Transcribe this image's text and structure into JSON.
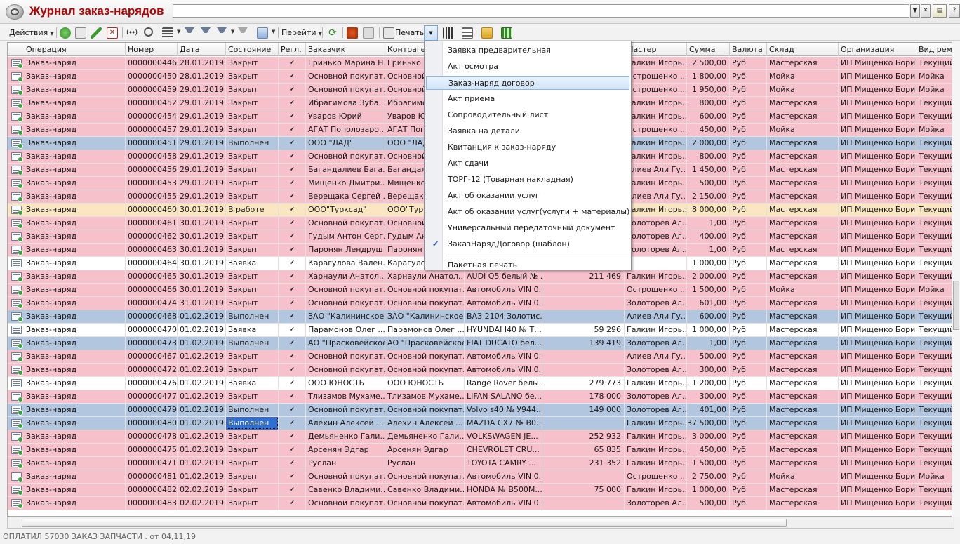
{
  "window": {
    "title": "Журнал заказ-нарядов",
    "search_value": ""
  },
  "toolbar": {
    "actions_label": "Действия",
    "goto_label": "Перейти",
    "print_label": "Печать"
  },
  "columns": [
    {
      "key": "operation",
      "label": "Операция"
    },
    {
      "key": "number",
      "label": "Номер"
    },
    {
      "key": "date",
      "label": "Дата"
    },
    {
      "key": "state",
      "label": "Состояние"
    },
    {
      "key": "regl",
      "label": "Регл."
    },
    {
      "key": "customer",
      "label": "Заказчик"
    },
    {
      "key": "counterparty",
      "label": "Контрагент"
    },
    {
      "key": "vehicle",
      "label": ""
    },
    {
      "key": "mileage",
      "label": ""
    },
    {
      "key": "master",
      "label": "Мастер"
    },
    {
      "key": "sum",
      "label": "Сумма"
    },
    {
      "key": "currency",
      "label": "Валюта"
    },
    {
      "key": "warehouse",
      "label": "Склад"
    },
    {
      "key": "org",
      "label": "Организация"
    },
    {
      "key": "repair",
      "label": "Вид ремо"
    }
  ],
  "colors": {
    "closed": "#f7c1cc",
    "done": "#b3c6df",
    "inwork": "#fbe6c2",
    "request": "#ffffff",
    "selection": "#2f6fd2"
  },
  "rows": [
    {
      "op": "Заказ-наряд",
      "num": "0000000446",
      "date": "28.01.2019",
      "state": "Закрыт",
      "cust": "Гринько Марина Н...",
      "cp": "Гринько М",
      "veh": "",
      "mil": "",
      "master": "Галкин Игорь...",
      "sum": "2 500,00",
      "cur": "Руб",
      "wh": "Мастерская",
      "org": "ИП Мищенко Бори...",
      "rep": "Текущий",
      "color": "#f7c1cc"
    },
    {
      "op": "Заказ-наряд",
      "num": "0000000450",
      "date": "28.01.2019",
      "state": "Закрыт",
      "cust": "Основной покупат...",
      "cp": "Основной",
      "veh": "",
      "mil": "",
      "master": "Острощенко ...",
      "sum": "1 800,00",
      "cur": "Руб",
      "wh": "Мойка",
      "org": "ИП Мищенко Бори...",
      "rep": "Мойка",
      "color": "#f7c1cc"
    },
    {
      "op": "Заказ-наряд",
      "num": "0000000459",
      "date": "29.01.2019",
      "state": "Закрыт",
      "cust": "Основной покупат...",
      "cp": "Основной",
      "veh": "",
      "mil": "",
      "master": "Острощенко ...",
      "sum": "1 950,00",
      "cur": "Руб",
      "wh": "Мойка",
      "org": "ИП Мищенко Бори...",
      "rep": "Мойка",
      "color": "#f7c1cc"
    },
    {
      "op": "Заказ-наряд",
      "num": "0000000452",
      "date": "29.01.2019",
      "state": "Закрыт",
      "cust": "Ибрагимова Зуба...",
      "cp": "Ибрагимов",
      "veh": "",
      "mil": "",
      "master": "Галкин Игорь...",
      "sum": "800,00",
      "cur": "Руб",
      "wh": "Мастерская",
      "org": "ИП Мищенко Бори...",
      "rep": "Текущий",
      "color": "#f7c1cc"
    },
    {
      "op": "Заказ-наряд",
      "num": "0000000454",
      "date": "29.01.2019",
      "state": "Закрыт",
      "cust": "Уваров Юрий",
      "cp": "Уваров Юр",
      "veh": "",
      "mil": "",
      "master": "Галкин Игорь...",
      "sum": "600,00",
      "cur": "Руб",
      "wh": "Мастерская",
      "org": "ИП Мищенко Бори...",
      "rep": "Текущий",
      "color": "#f7c1cc"
    },
    {
      "op": "Заказ-наряд",
      "num": "0000000457",
      "date": "29.01.2019",
      "state": "Закрыт",
      "cust": "АГАТ Пополозаро...",
      "cp": "АГАТ Попо",
      "veh": "",
      "mil": "",
      "master": "Острощенко ...",
      "sum": "450,00",
      "cur": "Руб",
      "wh": "Мойка",
      "org": "ИП Мищенко Бори...",
      "rep": "Мойка",
      "color": "#f7c1cc"
    },
    {
      "op": "Заказ-наряд",
      "num": "0000000451",
      "date": "29.01.2019",
      "state": "Выполнен",
      "cust": "ООО \"ЛАД\"",
      "cp": "ООО \"ЛАД\"",
      "veh": "",
      "mil": "",
      "master": "Галкин Игорь...",
      "sum": "2 000,00",
      "cur": "Руб",
      "wh": "Мастерская",
      "org": "ИП Мищенко Бори...",
      "rep": "Текущий",
      "color": "#b3c6df"
    },
    {
      "op": "Заказ-наряд",
      "num": "0000000458",
      "date": "29.01.2019",
      "state": "Закрыт",
      "cust": "Основной покупат...",
      "cp": "Основной",
      "veh": "",
      "mil": "",
      "master": "Галкин Игорь...",
      "sum": "800,00",
      "cur": "Руб",
      "wh": "Мастерская",
      "org": "ИП Мищенко Бори...",
      "rep": "Текущий",
      "color": "#f7c1cc"
    },
    {
      "op": "Заказ-наряд",
      "num": "0000000456",
      "date": "29.01.2019",
      "state": "Закрыт",
      "cust": "Багандалиев Бага...",
      "cp": "Багандали",
      "veh": "",
      "mil": "",
      "master": "Алиев Али Гу...",
      "sum": "1 450,00",
      "cur": "Руб",
      "wh": "Мастерская",
      "org": "ИП Мищенко Бори...",
      "rep": "Текущий",
      "color": "#f7c1cc"
    },
    {
      "op": "Заказ-наряд",
      "num": "0000000453",
      "date": "29.01.2019",
      "state": "Закрыт",
      "cust": "Мищенко Дмитри...",
      "cp": "Мищенко",
      "veh": "",
      "mil": "",
      "master": "Галкин Игорь...",
      "sum": "500,00",
      "cur": "Руб",
      "wh": "Мастерская",
      "org": "ИП Мищенко Бори...",
      "rep": "Текущий",
      "color": "#f7c1cc"
    },
    {
      "op": "Заказ-наряд",
      "num": "0000000455",
      "date": "29.01.2019",
      "state": "Закрыт",
      "cust": "Верещака Сергей ...",
      "cp": "Верещака",
      "veh": "",
      "mil": "",
      "master": "Алиев Али Гу...",
      "sum": "2 150,00",
      "cur": "Руб",
      "wh": "Мастерская",
      "org": "ИП Мищенко Бори...",
      "rep": "Текущий",
      "color": "#f7c1cc"
    },
    {
      "op": "Заказ-наряд",
      "num": "0000000460",
      "date": "30.01.2019",
      "state": "В работе",
      "cust": "ООО\"Турксад\"",
      "cp": "ООО\"Турк",
      "veh": "",
      "mil": "",
      "master": "Галкин Игорь...",
      "sum": "8 000,00",
      "cur": "Руб",
      "wh": "Мастерская",
      "org": "ИП Мищенко Бори...",
      "rep": "Текущий",
      "color": "#fbe6c2"
    },
    {
      "op": "Заказ-наряд",
      "num": "0000000461",
      "date": "30.01.2019",
      "state": "Закрыт",
      "cust": "Основной покупат...",
      "cp": "Основной",
      "veh": "",
      "mil": "",
      "master": "Золоторев Ал...",
      "sum": "1,00",
      "cur": "Руб",
      "wh": "Мастерская",
      "org": "ИП Мищенко Бори...",
      "rep": "Текущий",
      "color": "#f7c1cc"
    },
    {
      "op": "Заказ-наряд",
      "num": "0000000462",
      "date": "30.01.2019",
      "state": "Закрыт",
      "cust": "Гудым Антон Серг...",
      "cp": "Гудым Ант",
      "veh": "",
      "mil": "",
      "master": "Золоторев Ал...",
      "sum": "400,00",
      "cur": "Руб",
      "wh": "Мастерская",
      "org": "ИП Мищенко Бори...",
      "rep": "Текущий",
      "color": "#f7c1cc"
    },
    {
      "op": "Заказ-наряд",
      "num": "0000000463",
      "date": "30.01.2019",
      "state": "Закрыт",
      "cust": "Паронян Лендруш ...",
      "cp": "Паронян Л",
      "veh": "",
      "mil": "",
      "master": "Золоторев Ал...",
      "sum": "1,00",
      "cur": "Руб",
      "wh": "Мастерская",
      "org": "ИП Мищенко Бори...",
      "rep": "Текущий",
      "color": "#f7c1cc"
    },
    {
      "op": "Заказ-наряд",
      "num": "0000000464",
      "date": "30.01.2019",
      "state": "Заявка",
      "cust": "Карагулова Вален...",
      "cp": "Карагулов",
      "veh": "",
      "mil": "",
      "master": "",
      "sum": "1 000,00",
      "cur": "Руб",
      "wh": "Мастерская",
      "org": "ИП Мищенко Бори...",
      "rep": "Текущий",
      "color": "#ffffff"
    },
    {
      "op": "Заказ-наряд",
      "num": "0000000465",
      "date": "30.01.2019",
      "state": "Закрыт",
      "cust": "Харнаули Анатол...",
      "cp": "Харнаули Анатол...",
      "veh": "AUDI Q5 белый № ...",
      "mil": "211 469",
      "master": "Галкин Игорь...",
      "sum": "2 000,00",
      "cur": "Руб",
      "wh": "Мастерская",
      "org": "ИП Мищенко Бори...",
      "rep": "Текущий",
      "color": "#f7c1cc"
    },
    {
      "op": "Заказ-наряд",
      "num": "0000000466",
      "date": "30.01.2019",
      "state": "Закрыт",
      "cust": "Основной покупат...",
      "cp": "Основной покупат...",
      "veh": "Автомобиль VIN 0...",
      "mil": "",
      "master": "Острощенко ...",
      "sum": "1 500,00",
      "cur": "Руб",
      "wh": "Мойка",
      "org": "ИП Мищенко Бори...",
      "rep": "Мойка",
      "color": "#f7c1cc"
    },
    {
      "op": "Заказ-наряд",
      "num": "0000000474",
      "date": "31.01.2019",
      "state": "Закрыт",
      "cust": "Основной покупат...",
      "cp": "Основной покупат...",
      "veh": "Автомобиль VIN 0...",
      "mil": "",
      "master": "Золоторев Ал...",
      "sum": "601,00",
      "cur": "Руб",
      "wh": "Мастерская",
      "org": "ИП Мищенко Бори...",
      "rep": "Текущий",
      "color": "#f7c1cc"
    },
    {
      "op": "Заказ-наряд",
      "num": "0000000468",
      "date": "01.02.2019",
      "state": "Выполнен",
      "cust": "ЗАО \"Калининское\"",
      "cp": "ЗАО \"Калининское\"",
      "veh": "ВАЗ 2104 Золотис...",
      "mil": "",
      "master": "Алиев Али Гу...",
      "sum": "600,00",
      "cur": "Руб",
      "wh": "Мастерская",
      "org": "ИП Мищенко Бори...",
      "rep": "Текущий",
      "color": "#b3c6df"
    },
    {
      "op": "Заказ-наряд",
      "num": "0000000470",
      "date": "01.02.2019",
      "state": "Заявка",
      "cust": "Парамонов Олег ...",
      "cp": "Парамонов Олег ...",
      "veh": "HYUNDAI I40 № Т...",
      "mil": "59 296",
      "master": "Галкин Игорь...",
      "sum": "1 000,00",
      "cur": "Руб",
      "wh": "Мастерская",
      "org": "ИП Мищенко Бори...",
      "rep": "Текущий",
      "color": "#ffffff"
    },
    {
      "op": "Заказ-наряд",
      "num": "0000000473",
      "date": "01.02.2019",
      "state": "Выполнен",
      "cust": "АО \"Прасковейское",
      "cp": "АО \"Прасковейское",
      "veh": "FIAT DUCATO бел...",
      "mil": "139 419",
      "master": "Золоторев Ал...",
      "sum": "1,00",
      "cur": "Руб",
      "wh": "Мастерская",
      "org": "ИП Мищенко Бори...",
      "rep": "Текущий",
      "color": "#b3c6df"
    },
    {
      "op": "Заказ-наряд",
      "num": "0000000467",
      "date": "01.02.2019",
      "state": "Закрыт",
      "cust": "Основной покупат...",
      "cp": "Основной покупат...",
      "veh": "Автомобиль VIN 0...",
      "mil": "",
      "master": "Алиев Али Гу...",
      "sum": "500,00",
      "cur": "Руб",
      "wh": "Мастерская",
      "org": "ИП Мищенко Бори...",
      "rep": "Текущий",
      "color": "#f7c1cc"
    },
    {
      "op": "Заказ-наряд",
      "num": "0000000472",
      "date": "01.02.2019",
      "state": "Закрыт",
      "cust": "Основной покупат...",
      "cp": "Основной покупат...",
      "veh": "Автомобиль VIN 0...",
      "mil": "",
      "master": "Золоторев Ал...",
      "sum": "300,00",
      "cur": "Руб",
      "wh": "Мастерская",
      "org": "ИП Мищенко Бори...",
      "rep": "Текущий",
      "color": "#f7c1cc"
    },
    {
      "op": "Заказ-наряд",
      "num": "0000000476",
      "date": "01.02.2019",
      "state": "Заявка",
      "cust": "ООО ЮНОСТЬ",
      "cp": "ООО ЮНОСТЬ",
      "veh": "Range Rover белы...",
      "mil": "279 773",
      "master": "Галкин Игорь...",
      "sum": "1 200,00",
      "cur": "Руб",
      "wh": "Мастерская",
      "org": "ИП Мищенко Бори...",
      "rep": "Текущий",
      "color": "#ffffff"
    },
    {
      "op": "Заказ-наряд",
      "num": "0000000477",
      "date": "01.02.2019",
      "state": "Закрыт",
      "cust": "Тлизамов Мухаме...",
      "cp": "Тлизамов Мухаме...",
      "veh": "LIFAN SALANO бе...",
      "mil": "178 000",
      "master": "Золоторев Ал...",
      "sum": "300,00",
      "cur": "Руб",
      "wh": "Мастерская",
      "org": "ИП Мищенко Бори...",
      "rep": "Текущий",
      "color": "#f7c1cc"
    },
    {
      "op": "Заказ-наряд",
      "num": "0000000479",
      "date": "01.02.2019",
      "state": "Выполнен",
      "cust": "Основной покупат...",
      "cp": "Основной покупат...",
      "veh": "Volvo s40 № У944...",
      "mil": "149 000",
      "master": "Золоторев Ал...",
      "sum": "401,00",
      "cur": "Руб",
      "wh": "Мастерская",
      "org": "ИП Мищенко Бори...",
      "rep": "Текущий",
      "color": "#b3c6df"
    },
    {
      "op": "Заказ-наряд",
      "num": "0000000480",
      "date": "01.02.2019",
      "state": "Выполнен",
      "cust": "Алёхин Алексей ...",
      "cp": "Алёхин Алексей ...",
      "veh": "MAZDA CX7 № В0...",
      "mil": "",
      "master": "Галкин Игорь...",
      "sum": "37 500,00",
      "cur": "Руб",
      "wh": "Мастерская",
      "org": "ИП Мищенко Бори...",
      "rep": "Текущий",
      "color": "#b3c6df",
      "selected": true
    },
    {
      "op": "Заказ-наряд",
      "num": "0000000478",
      "date": "01.02.2019",
      "state": "Закрыт",
      "cust": "Демьяненко Гали...",
      "cp": "Демьяненко Гали...",
      "veh": "VOLKSWAGEN JE...",
      "mil": "252 932",
      "master": "Галкин Игорь...",
      "sum": "3 000,00",
      "cur": "Руб",
      "wh": "Мастерская",
      "org": "ИП Мищенко Бори...",
      "rep": "Текущий",
      "color": "#f7c1cc"
    },
    {
      "op": "Заказ-наряд",
      "num": "0000000475",
      "date": "01.02.2019",
      "state": "Закрыт",
      "cust": "Арсенян Эдгар",
      "cp": "Арсенян Эдгар",
      "veh": "CHEVROLET CRU...",
      "mil": "65 835",
      "master": "Галкин Игорь...",
      "sum": "450,00",
      "cur": "Руб",
      "wh": "Мастерская",
      "org": "ИП Мищенко Бори...",
      "rep": "Текущий",
      "color": "#f7c1cc"
    },
    {
      "op": "Заказ-наряд",
      "num": "0000000471",
      "date": "01.02.2019",
      "state": "Закрыт",
      "cust": "Руслан",
      "cp": "Руслан",
      "veh": "TOYOTA CAMRY ...",
      "mil": "231 352",
      "master": "Галкин Игорь...",
      "sum": "1 500,00",
      "cur": "Руб",
      "wh": "Мастерская",
      "org": "ИП Мищенко Бори...",
      "rep": "Текущий",
      "color": "#f7c1cc"
    },
    {
      "op": "Заказ-наряд",
      "num": "0000000481",
      "date": "01.02.2019",
      "state": "Закрыт",
      "cust": "Основной покупат...",
      "cp": "Основной покупат...",
      "veh": "Автомобиль VIN 0...",
      "mil": "",
      "master": "Острощенко ...",
      "sum": "2 750,00",
      "cur": "Руб",
      "wh": "Мойка",
      "org": "ИП Мищенко Бори...",
      "rep": "Мойка",
      "color": "#f7c1cc"
    },
    {
      "op": "Заказ-наряд",
      "num": "0000000482",
      "date": "02.02.2019",
      "state": "Закрыт",
      "cust": "Савенко Владими...",
      "cp": "Савенко Владими...",
      "veh": "HONDA № В500М...",
      "mil": "75 000",
      "master": "Галкин Игорь...",
      "sum": "1 000,00",
      "cur": "Руб",
      "wh": "Мастерская",
      "org": "ИП Мищенко Бори...",
      "rep": "Текущий",
      "color": "#f7c1cc"
    },
    {
      "op": "Заказ-наряд",
      "num": "0000000483",
      "date": "02.02.2019",
      "state": "Закрыт",
      "cust": "Основной покупат...",
      "cp": "Основной покупат...",
      "veh": "Автомобиль VIN 0...",
      "mil": "",
      "master": "Золоторев Ал...",
      "sum": "500,00",
      "cur": "Руб",
      "wh": "Мастерская",
      "org": "ИП Мищенко Бори...",
      "rep": "Текущий",
      "color": "#f7c1cc"
    }
  ],
  "print_menu": {
    "items": [
      {
        "label": "Заявка предварительная"
      },
      {
        "label": "Акт осмотра"
      },
      {
        "label": "Заказ-наряд договор",
        "highlighted": true
      },
      {
        "label": "Акт приема"
      },
      {
        "label": "Сопроводительный лист"
      },
      {
        "label": "Заявка на детали"
      },
      {
        "label": "Квитанция к заказ-наряду"
      },
      {
        "label": "Акт сдачи"
      },
      {
        "label": "ТОРГ-12 (Товарная накладная)"
      },
      {
        "label": "Акт об оказании услуг"
      },
      {
        "label": "Акт об оказании услуг(услуги + материалы)"
      },
      {
        "label": "Универсальный передаточный документ"
      },
      {
        "label": "ЗаказНарядДоговор (шаблон)",
        "checked": true
      },
      {
        "label": "Пакетная печать"
      }
    ]
  },
  "status": {
    "text": "ОПЛАТИЛ 57030 ЗАКАЗ ЗАПЧАСТИ . от 04,11,19"
  }
}
